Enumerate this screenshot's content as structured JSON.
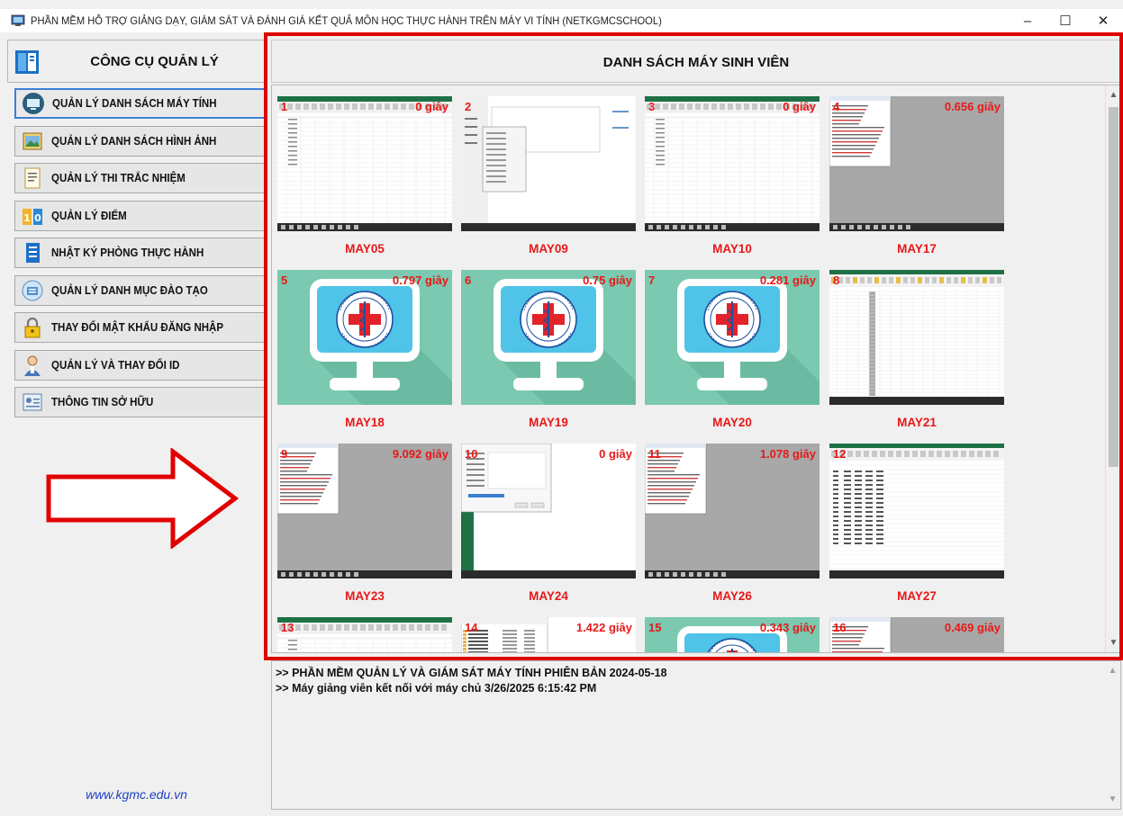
{
  "window": {
    "title": "PHẦN MỀM HỖ TRỢ GIẢNG DẠY, GIÁM SÁT VÀ ĐÁNH GIÁ KẾT QUẢ MÔN HỌC THỰC HÀNH TRÊN MÁY VI TÍNH (NETKGMCSCHOOL)",
    "minimize": "–",
    "maximize": "☐",
    "close": "✕"
  },
  "left": {
    "title": "CÔNG CỤ QUẢN LÝ",
    "menu": [
      {
        "label": "QUẢN LÝ DANH SÁCH MÁY TÍNH",
        "icon": "computer-list-icon"
      },
      {
        "label": "QUẢN LÝ DANH SÁCH HÌNH ẢNH",
        "icon": "image-list-icon"
      },
      {
        "label": "QUẢN LÝ THI TRẮC NHIỆM",
        "icon": "quiz-icon"
      },
      {
        "label": "QUẢN LÝ ĐIỂM",
        "icon": "score-icon"
      },
      {
        "label": "NHẬT KÝ PHÒNG THỰC HÀNH",
        "icon": "logbook-icon"
      },
      {
        "label": "QUẢN LÝ DANH MỤC ĐÀO TẠO",
        "icon": "training-catalog-icon"
      },
      {
        "label": "THAY ĐỔI MẬT KHẨU ĐĂNG NHẬP",
        "icon": "lock-icon"
      },
      {
        "label": "QUẢN LÝ VÀ THAY ĐỔI ID",
        "icon": "user-id-icon"
      },
      {
        "label": "THÔNG TIN SỞ HỮU",
        "icon": "ownership-info-icon"
      }
    ],
    "website": "www.kgmc.edu.vn"
  },
  "right": {
    "title": "DANH SÁCH MÁY SINH VIÊN"
  },
  "machines": [
    {
      "num": "1",
      "time": "0 giây",
      "name": "MAY05",
      "screen": "excel"
    },
    {
      "num": "2",
      "time": "",
      "name": "MAY09",
      "screen": "dialog"
    },
    {
      "num": "3",
      "time": "0 giây",
      "name": "MAY10",
      "screen": "excel"
    },
    {
      "num": "4",
      "time": "0.656 giây",
      "name": "MAY17",
      "screen": "gray-notepad"
    },
    {
      "num": "5",
      "time": "0.797 giây",
      "name": "MAY18",
      "screen": "logo"
    },
    {
      "num": "6",
      "time": "0.75 giây",
      "name": "MAY19",
      "screen": "logo"
    },
    {
      "num": "7",
      "time": "0.281 giây",
      "name": "MAY20",
      "screen": "logo"
    },
    {
      "num": "8",
      "time": "",
      "name": "MAY21",
      "screen": "excel-narrow"
    },
    {
      "num": "9",
      "time": "9.092 giây",
      "name": "MAY23",
      "screen": "gray-notepad"
    },
    {
      "num": "10",
      "time": "0 giây",
      "name": "MAY24",
      "screen": "green-dialog"
    },
    {
      "num": "11",
      "time": "1.078 giây",
      "name": "MAY26",
      "screen": "gray-notepad"
    },
    {
      "num": "12",
      "time": "",
      "name": "MAY27",
      "screen": "excel-table"
    },
    {
      "num": "13",
      "time": "",
      "name": "",
      "screen": "excel"
    },
    {
      "num": "14",
      "time": "1.422 giây",
      "name": "",
      "screen": "explorer"
    },
    {
      "num": "15",
      "time": "0.343 giây",
      "name": "",
      "screen": "logo"
    },
    {
      "num": "16",
      "time": "0.469 giây",
      "name": "",
      "screen": "gray-notepad"
    }
  ],
  "log": {
    "line1": ">> PHẦN MỀM QUẢN LÝ VÀ GIÁM SÁT MÁY TÍNH PHIÊN BẢN 2024-05-18",
    "line2": ">> Máy giảng viên kết nối với máy chủ 3/26/2025 6:15:42 PM"
  },
  "colors": {
    "highlight": "#e00000",
    "label_red": "#e81818",
    "logo_bg": "#7ac9b0",
    "link_blue": "#1d3fc4"
  }
}
